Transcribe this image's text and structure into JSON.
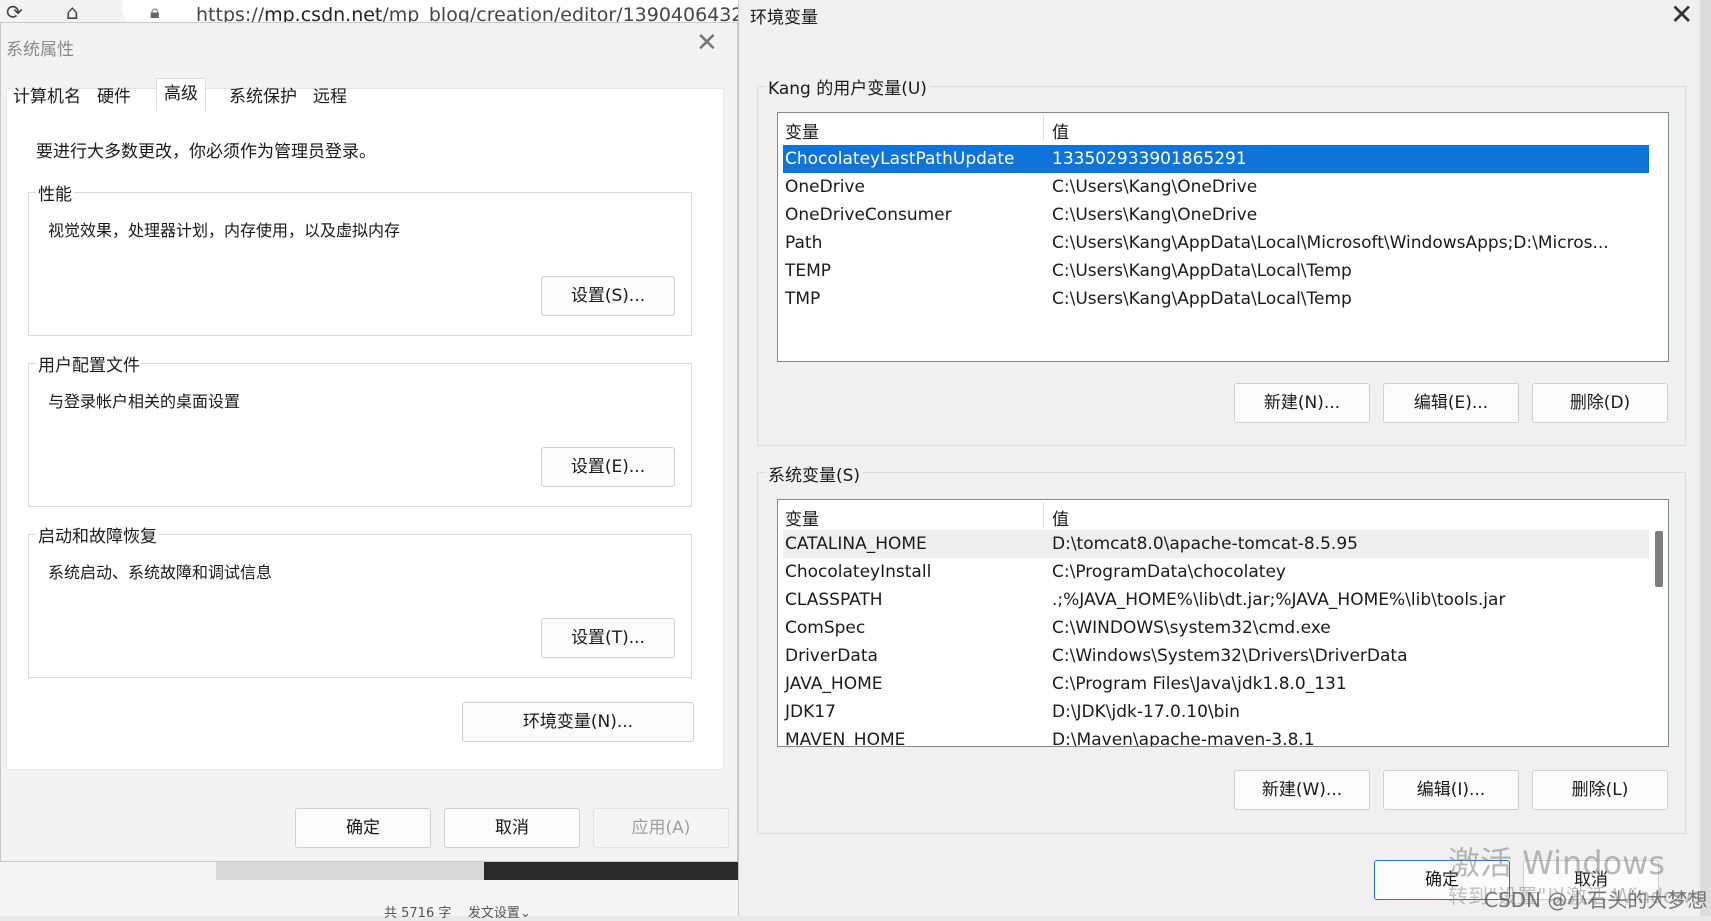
{
  "browser": {
    "url_host": "mp.csdn.net",
    "url_path": "/mp_blog/creation/editor/1390406432",
    "url_prefix": "https://",
    "status_words": "共 5716 字",
    "publish_settings": "发文设置"
  },
  "system_properties": {
    "title": "系统属性",
    "tabs": [
      "计算机名",
      "硬件",
      "高级",
      "系统保护",
      "远程"
    ],
    "active_tab": "高级",
    "admin_note": "要进行大多数更改，你必须作为管理员登录。",
    "groups": [
      {
        "label": "性能",
        "description": "视觉效果，处理器计划，内存使用，以及虚拟内存",
        "button": "设置(S)..."
      },
      {
        "label": "用户配置文件",
        "description": "与登录帐户相关的桌面设置",
        "button": "设置(E)..."
      },
      {
        "label": "启动和故障恢复",
        "description": "系统启动、系统故障和调试信息",
        "button": "设置(T)..."
      }
    ],
    "env_button": "环境变量(N)...",
    "ok": "确定",
    "cancel": "取消",
    "apply": "应用(A)"
  },
  "environment_variables": {
    "title": "环境变量",
    "user_section": {
      "label": "Kang 的用户变量(U)",
      "col_name": "变量",
      "col_value": "值",
      "rows": [
        {
          "name": "ChocolateyLastPathUpdate",
          "value": "133502933901865291"
        },
        {
          "name": "OneDrive",
          "value": "C:\\Users\\Kang\\OneDrive"
        },
        {
          "name": "OneDriveConsumer",
          "value": "C:\\Users\\Kang\\OneDrive"
        },
        {
          "name": "Path",
          "value": "C:\\Users\\Kang\\AppData\\Local\\Microsoft\\WindowsApps;D:\\Micros..."
        },
        {
          "name": "TEMP",
          "value": "C:\\Users\\Kang\\AppData\\Local\\Temp"
        },
        {
          "name": "TMP",
          "value": "C:\\Users\\Kang\\AppData\\Local\\Temp"
        }
      ],
      "selected_index": 0,
      "buttons": {
        "new": "新建(N)...",
        "edit": "编辑(E)...",
        "delete": "删除(D)"
      }
    },
    "system_section": {
      "label": "系统变量(S)",
      "col_name": "变量",
      "col_value": "值",
      "rows": [
        {
          "name": "CATALINA_HOME",
          "value": "D:\\tomcat8.0\\apache-tomcat-8.5.95"
        },
        {
          "name": "ChocolateyInstall",
          "value": "C:\\ProgramData\\chocolatey"
        },
        {
          "name": "CLASSPATH",
          "value": ".;%JAVA_HOME%\\lib\\dt.jar;%JAVA_HOME%\\lib\\tools.jar"
        },
        {
          "name": "ComSpec",
          "value": "C:\\WINDOWS\\system32\\cmd.exe"
        },
        {
          "name": "DriverData",
          "value": "C:\\Windows\\System32\\Drivers\\DriverData"
        },
        {
          "name": "JAVA_HOME",
          "value": "C:\\Program Files\\Java\\jdk1.8.0_131"
        },
        {
          "name": "JDK17",
          "value": "D:\\JDK\\jdk-17.0.10\\bin"
        },
        {
          "name": "MAVEN_HOME",
          "value": "D:\\Maven\\apache-maven-3.8.1"
        }
      ],
      "hover_index": 0,
      "buttons": {
        "new": "新建(W)...",
        "edit": "编辑(I)...",
        "delete": "删除(L)"
      }
    },
    "ok": "确定",
    "cancel": "取消"
  },
  "overlay": {
    "activate_windows": "激活 Windows",
    "activate_hint": "转到\"设置\"以激活 Windows",
    "csdn_watermark": "CSDN @小石头的大梦想"
  },
  "colors": {
    "selection": "#0e74d9",
    "dialog_bg": "#f0f0f0",
    "panel_bg": "#ffffff"
  }
}
